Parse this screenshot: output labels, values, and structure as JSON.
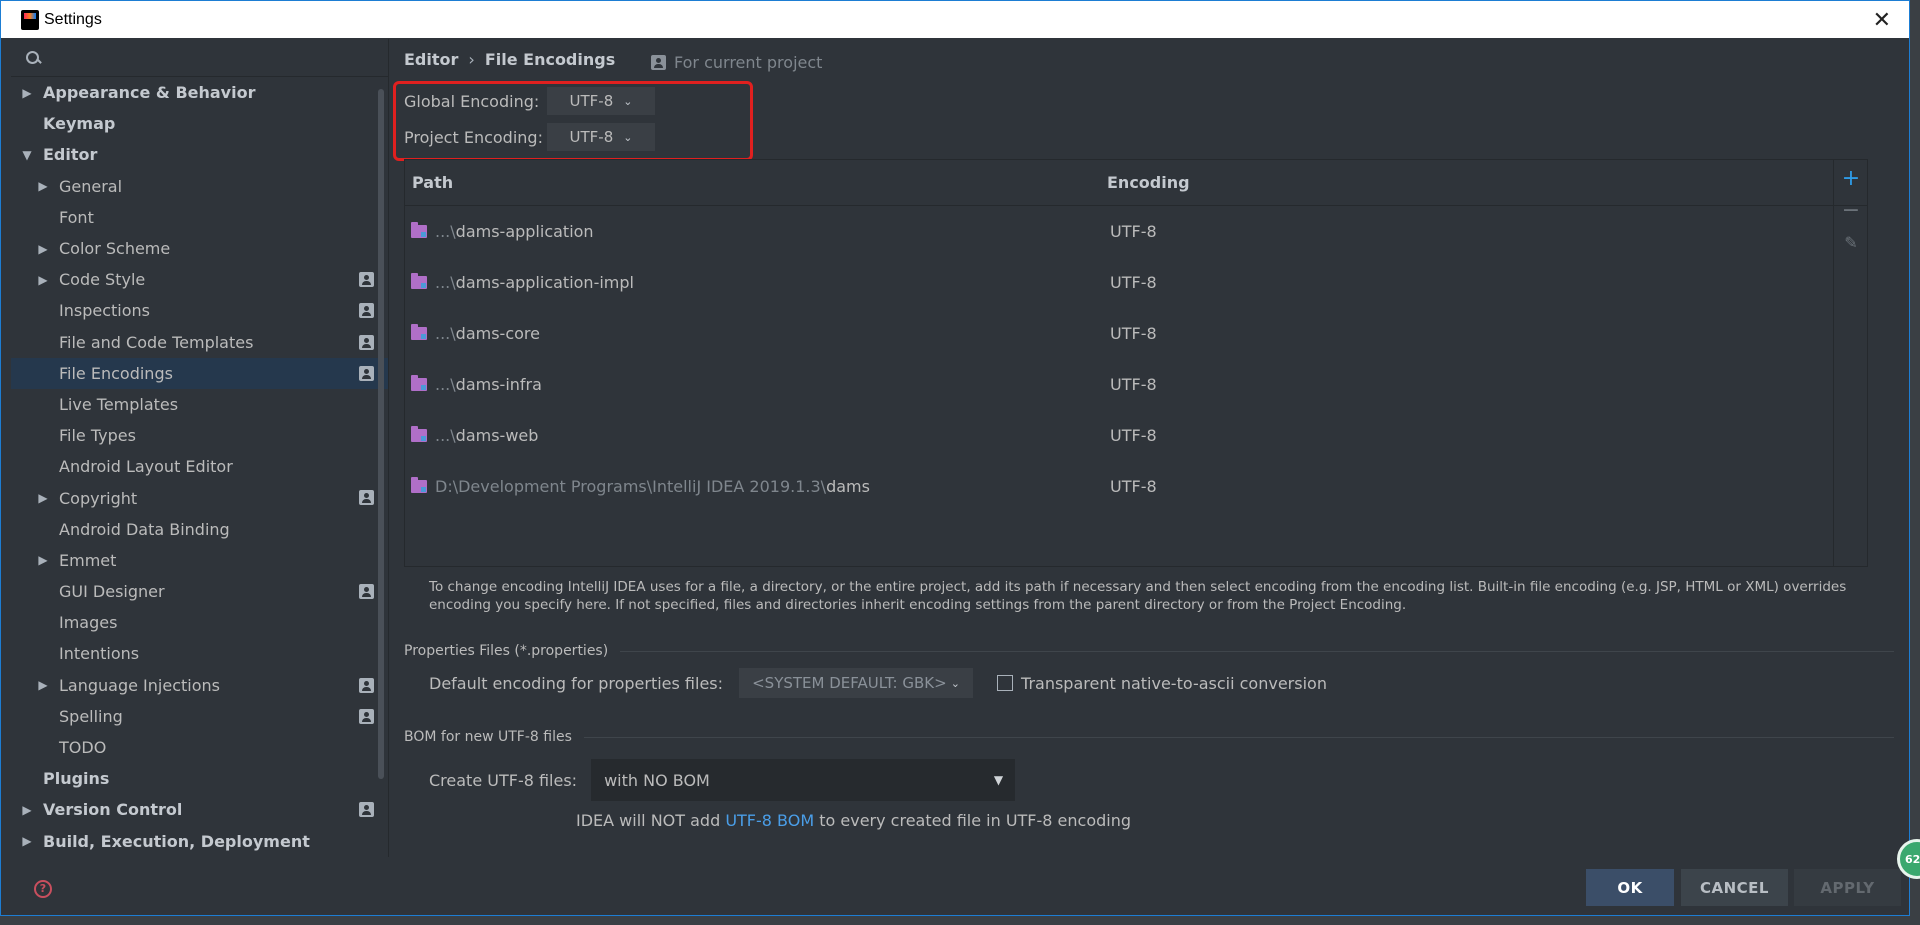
{
  "window": {
    "title": "Settings",
    "close_glyph": "✕"
  },
  "sidebar": {
    "search_placeholder": "",
    "items": [
      {
        "label": "Appearance & Behavior",
        "level": 0,
        "arrow": "▶",
        "bold": true,
        "project": false
      },
      {
        "label": "Keymap",
        "level": 0,
        "arrow": "",
        "bold": true,
        "project": false
      },
      {
        "label": "Editor",
        "level": 0,
        "arrow": "▼",
        "bold": true,
        "project": false
      },
      {
        "label": "General",
        "level": 1,
        "arrow": "▶",
        "bold": false,
        "project": false
      },
      {
        "label": "Font",
        "level": 1,
        "arrow": "",
        "bold": false,
        "project": false
      },
      {
        "label": "Color Scheme",
        "level": 1,
        "arrow": "▶",
        "bold": false,
        "project": false
      },
      {
        "label": "Code Style",
        "level": 1,
        "arrow": "▶",
        "bold": false,
        "project": true
      },
      {
        "label": "Inspections",
        "level": 1,
        "arrow": "",
        "bold": false,
        "project": true
      },
      {
        "label": "File and Code Templates",
        "level": 1,
        "arrow": "",
        "bold": false,
        "project": true
      },
      {
        "label": "File Encodings",
        "level": 1,
        "arrow": "",
        "bold": false,
        "project": true,
        "selected": true
      },
      {
        "label": "Live Templates",
        "level": 1,
        "arrow": "",
        "bold": false,
        "project": false
      },
      {
        "label": "File Types",
        "level": 1,
        "arrow": "",
        "bold": false,
        "project": false
      },
      {
        "label": "Android Layout Editor",
        "level": 1,
        "arrow": "",
        "bold": false,
        "project": false
      },
      {
        "label": "Copyright",
        "level": 1,
        "arrow": "▶",
        "bold": false,
        "project": true
      },
      {
        "label": "Android Data Binding",
        "level": 1,
        "arrow": "",
        "bold": false,
        "project": false
      },
      {
        "label": "Emmet",
        "level": 1,
        "arrow": "▶",
        "bold": false,
        "project": false
      },
      {
        "label": "GUI Designer",
        "level": 1,
        "arrow": "",
        "bold": false,
        "project": true
      },
      {
        "label": "Images",
        "level": 1,
        "arrow": "",
        "bold": false,
        "project": false
      },
      {
        "label": "Intentions",
        "level": 1,
        "arrow": "",
        "bold": false,
        "project": false
      },
      {
        "label": "Language Injections",
        "level": 1,
        "arrow": "▶",
        "bold": false,
        "project": true
      },
      {
        "label": "Spelling",
        "level": 1,
        "arrow": "",
        "bold": false,
        "project": true
      },
      {
        "label": "TODO",
        "level": 1,
        "arrow": "",
        "bold": false,
        "project": false
      },
      {
        "label": "Plugins",
        "level": 0,
        "arrow": "",
        "bold": true,
        "project": false
      },
      {
        "label": "Version Control",
        "level": 0,
        "arrow": "▶",
        "bold": true,
        "project": true
      },
      {
        "label": "Build, Execution, Deployment",
        "level": 0,
        "arrow": "▶",
        "bold": true,
        "project": false
      }
    ],
    "help_glyph": "?"
  },
  "main": {
    "breadcrumb": {
      "parent": "Editor",
      "separator": "›",
      "current": "File Encodings"
    },
    "scope_label": "For current project",
    "global_encoding": {
      "label": "Global Encoding:",
      "value": "UTF-8"
    },
    "project_encoding": {
      "label": "Project Encoding:",
      "value": "UTF-8"
    },
    "table": {
      "headers": {
        "path": "Path",
        "encoding": "Encoding"
      },
      "rows": [
        {
          "prefix": "...\\",
          "name": "dams-application",
          "encoding": "UTF-8"
        },
        {
          "prefix": "...\\",
          "name": "dams-application-impl",
          "encoding": "UTF-8"
        },
        {
          "prefix": "...\\",
          "name": "dams-core",
          "encoding": "UTF-8"
        },
        {
          "prefix": "...\\",
          "name": "dams-infra",
          "encoding": "UTF-8"
        },
        {
          "prefix": "...\\",
          "name": "dams-web",
          "encoding": "UTF-8"
        },
        {
          "prefix": "D:\\Development Programs\\IntelliJ IDEA 2019.1.3\\",
          "name": "dams",
          "encoding": "UTF-8"
        }
      ],
      "tools": {
        "add": "+",
        "remove": "−",
        "edit": "✎"
      }
    },
    "info_text": "To change encoding IntelliJ IDEA uses for a file, a directory, or the entire project, add its path if necessary and then select encoding from the encoding list. Built-in file encoding (e.g. JSP, HTML or XML) overrides encoding you specify here. If not specified, files and directories inherit encoding settings from the parent directory or from the Project Encoding.",
    "properties": {
      "section_title": "Properties Files (*.properties)",
      "default_label": "Default encoding for properties files:",
      "default_value": "<SYSTEM DEFAULT: GBK>",
      "transparent_label": "Transparent native-to-ascii conversion",
      "transparent_checked": false
    },
    "bom": {
      "section_title": "BOM for new UTF-8 files",
      "create_label": "Create UTF-8 files:",
      "create_value": "with NO BOM",
      "note_prefix": "IDEA will NOT add ",
      "note_link": "UTF-8 BOM",
      "note_suffix": " to every created file in UTF-8 encoding"
    }
  },
  "buttons": {
    "ok": "OK",
    "cancel": "CANCEL",
    "apply": "APPLY"
  },
  "badge_text": "62",
  "colors": {
    "accent": "#1d7dd3",
    "highlight_box": "#e0201f",
    "link": "#4a9ee8",
    "selected_row": "#25384d"
  }
}
